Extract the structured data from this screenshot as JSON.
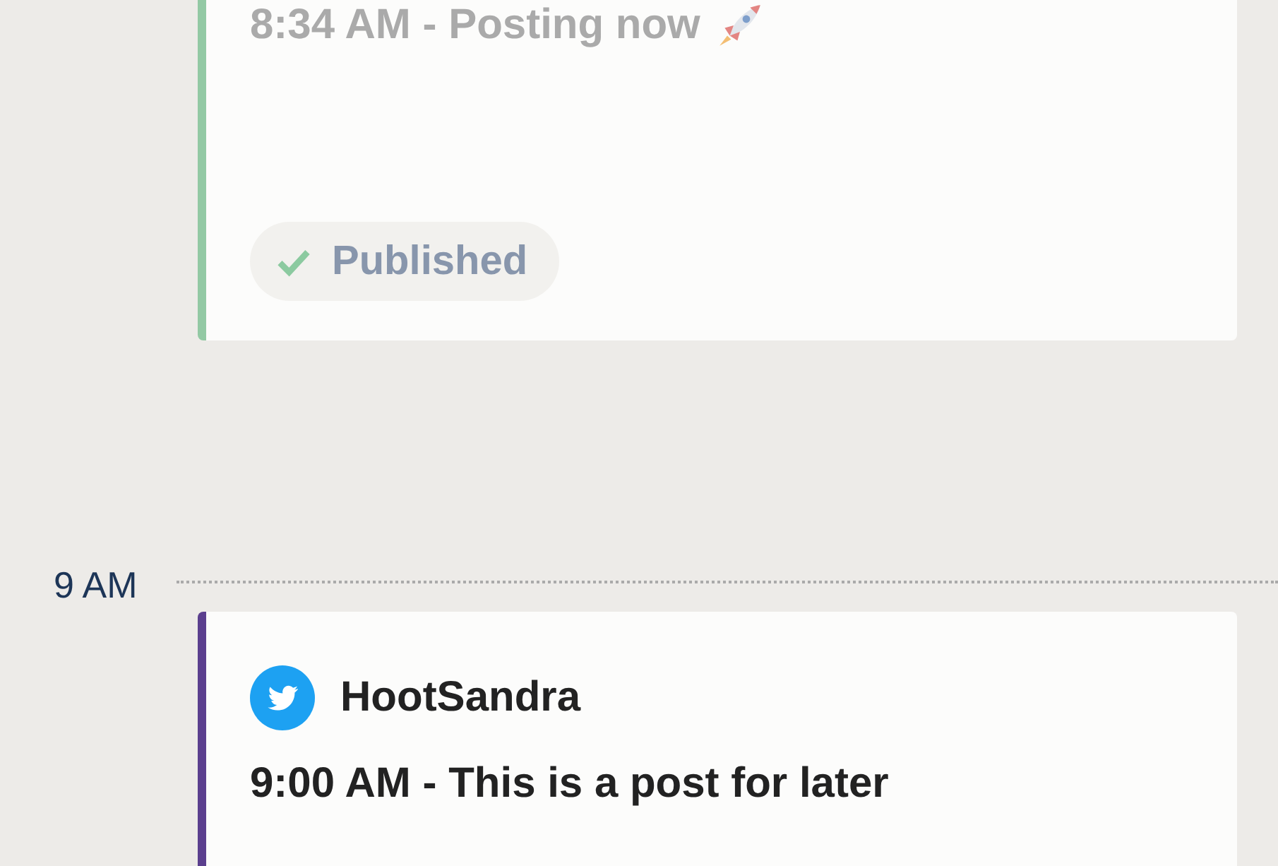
{
  "timeline": [
    {
      "kind": "post",
      "color": "#93c9a4",
      "faded": true,
      "has_emoji": true,
      "text": "8:34 AM - Posting now",
      "status": "Published"
    },
    {
      "kind": "hour",
      "label": "9 AM"
    },
    {
      "kind": "post",
      "color": "#5b3f8e",
      "faded": false,
      "has_emoji": false,
      "account": {
        "kind": "twitter",
        "name": "HootSandra"
      },
      "text": "9:00 AM - This is a post for later"
    }
  ]
}
